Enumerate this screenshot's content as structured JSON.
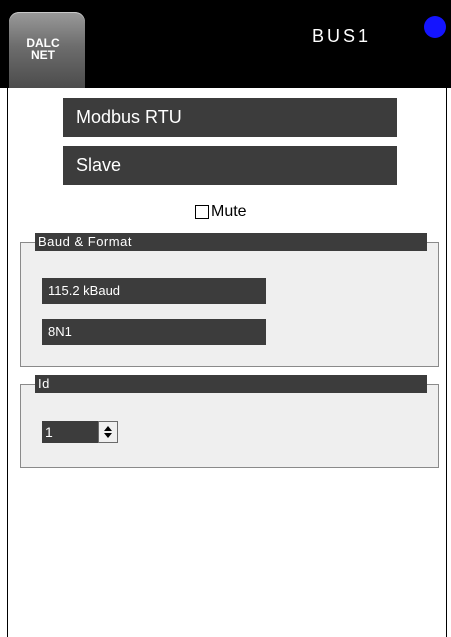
{
  "header": {
    "logo_text": "DALC\nNET",
    "title": "BUS1",
    "status_color": "#1414ff"
  },
  "protocol": {
    "value": "Modbus RTU"
  },
  "role": {
    "value": "Slave"
  },
  "mute": {
    "label": "Mute",
    "checked": false
  },
  "baud_group": {
    "title": "Baud & Format",
    "baud_value": "115.2 kBaud",
    "format_value": "8N1"
  },
  "id_group": {
    "title": "Id",
    "id_value": "1"
  }
}
